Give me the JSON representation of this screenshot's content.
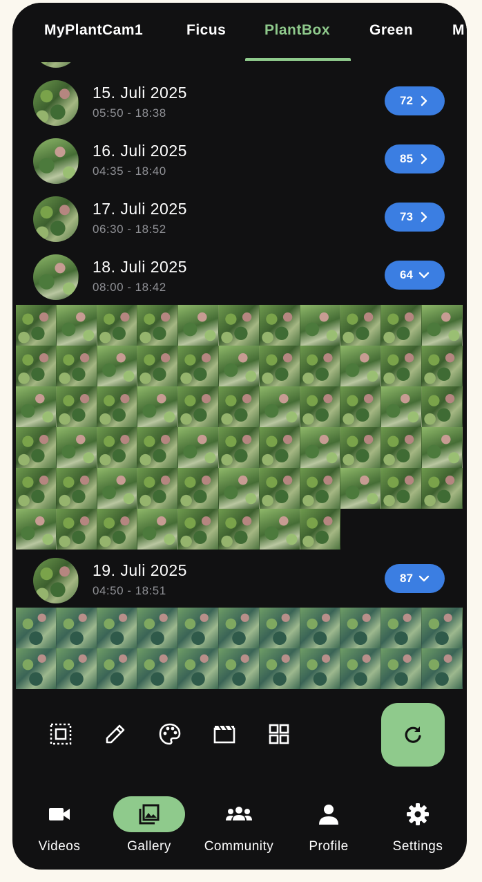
{
  "tabs": [
    {
      "label": "MyPlantCam1",
      "active": false
    },
    {
      "label": "Ficus",
      "active": false
    },
    {
      "label": "PlantBox",
      "active": true
    },
    {
      "label": "Green",
      "active": false
    },
    {
      "label": "M",
      "active": false
    }
  ],
  "days": [
    {
      "date": "15. Juli 2025",
      "time": "05:50 - 18:38",
      "count": "72",
      "expanded": false
    },
    {
      "date": "16. Juli 2025",
      "time": "04:35 - 18:40",
      "count": "85",
      "expanded": false
    },
    {
      "date": "17. Juli 2025",
      "time": "06:30 - 18:52",
      "count": "73",
      "expanded": false
    },
    {
      "date": "18. Juli 2025",
      "time": "08:00 - 18:42",
      "count": "64",
      "expanded": true
    },
    {
      "date": "19. Juli 2025",
      "time": "04:50 - 18:51",
      "count": "87",
      "expanded": true
    }
  ],
  "toolbar": {
    "icons": [
      "select-all-icon",
      "edit-icon",
      "palette-icon",
      "movie-clapper-icon",
      "grid-view-icon"
    ],
    "fab_icon": "refresh-icon"
  },
  "nav": [
    {
      "label": "Videos",
      "icon": "videocam-icon",
      "active": false
    },
    {
      "label": "Gallery",
      "icon": "photo-library-icon",
      "active": true
    },
    {
      "label": "Community",
      "icon": "groups-icon",
      "active": false
    },
    {
      "label": "Profile",
      "icon": "person-icon",
      "active": false
    },
    {
      "label": "Settings",
      "icon": "gear-icon",
      "active": false
    }
  ],
  "colors": {
    "background": "#111112",
    "accent": "#8fca8c",
    "count_badge": "#3b7ee2",
    "outer": "#fbf8ef"
  }
}
